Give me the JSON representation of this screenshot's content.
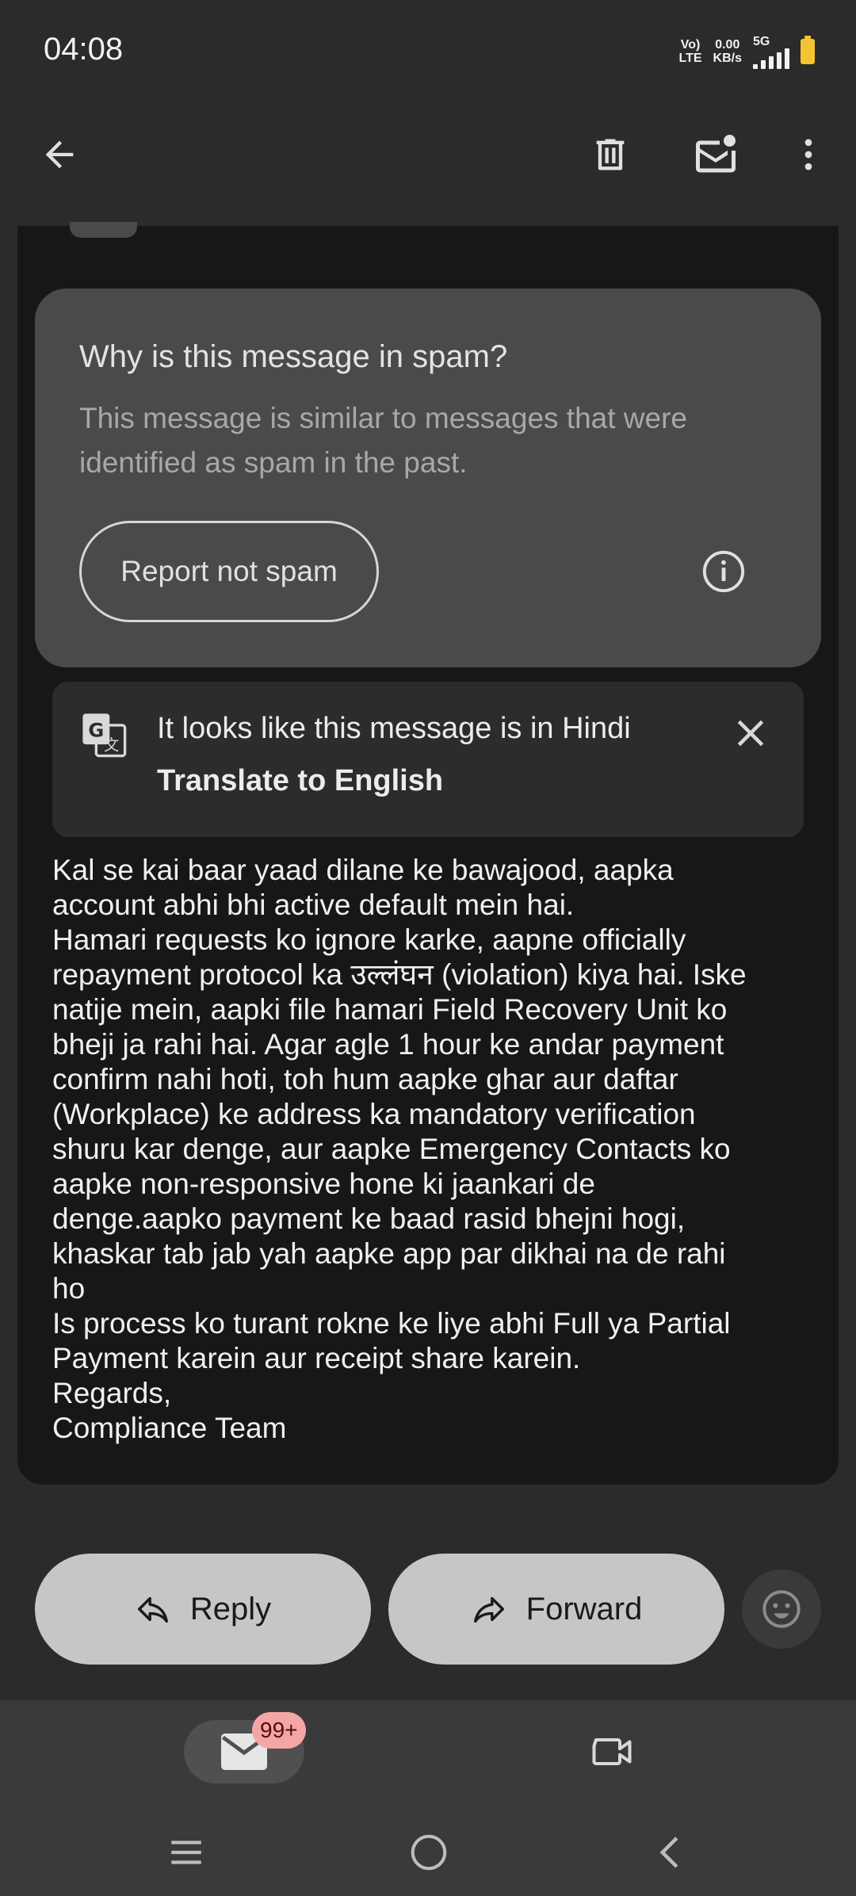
{
  "status_bar": {
    "time": "04:08",
    "volte": "Vo)",
    "lte": "LTE",
    "speed_value": "0.00",
    "speed_unit": "KB/s",
    "network": "5G"
  },
  "app_bar": {
    "icons": [
      "back-arrow-icon",
      "delete-icon",
      "mark-unread-icon",
      "more-vert-icon"
    ]
  },
  "spam_notice": {
    "title": "Why is this message in spam?",
    "description": "This message is similar to messages that were identified as spam in the past.",
    "report_button": "Report not spam"
  },
  "translate_banner": {
    "message": "It looks like this message is in Hindi",
    "action": "Translate to English"
  },
  "email": {
    "body": "Kal se kai baar yaad dilane ke bawajood, aapka\naccount abhi bhi active default mein hai.\nHamari requests ko ignore karke, aapne officially\nrepayment protocol ka उल्लंघन (violation) kiya hai. Iske\nnatije mein, aapki file hamari Field Recovery Unit ko\nbheji ja rahi hai. Agar agle 1 hour ke andar payment\nconfirm nahi hoti, toh hum aapke ghar aur daftar\n(Workplace) ke address ka mandatory verification\nshuru kar denge, aur aapke Emergency Contacts ko\naapke non-responsive hone ki jaankari de\ndenge.aapko payment ke baad rasid bhejni hogi,\nkhaskar tab jab yah aapke app par dikhai na de rahi\nho\nIs process ko turant rokne ke liye abhi Full ya Partial\nPayment karein aur receipt share karein.\nRegards,\nCompliance Team"
  },
  "actions": {
    "reply": "Reply",
    "forward": "Forward"
  },
  "bottom_nav": {
    "mail_badge": "99+"
  },
  "colors": {
    "background": "#2b2b2b",
    "email_card": "#171717",
    "spam_card": "#4a4a4a",
    "action_button": "#c6c6c6",
    "badge": "#f4a6a6",
    "battery": "#f4c430"
  }
}
